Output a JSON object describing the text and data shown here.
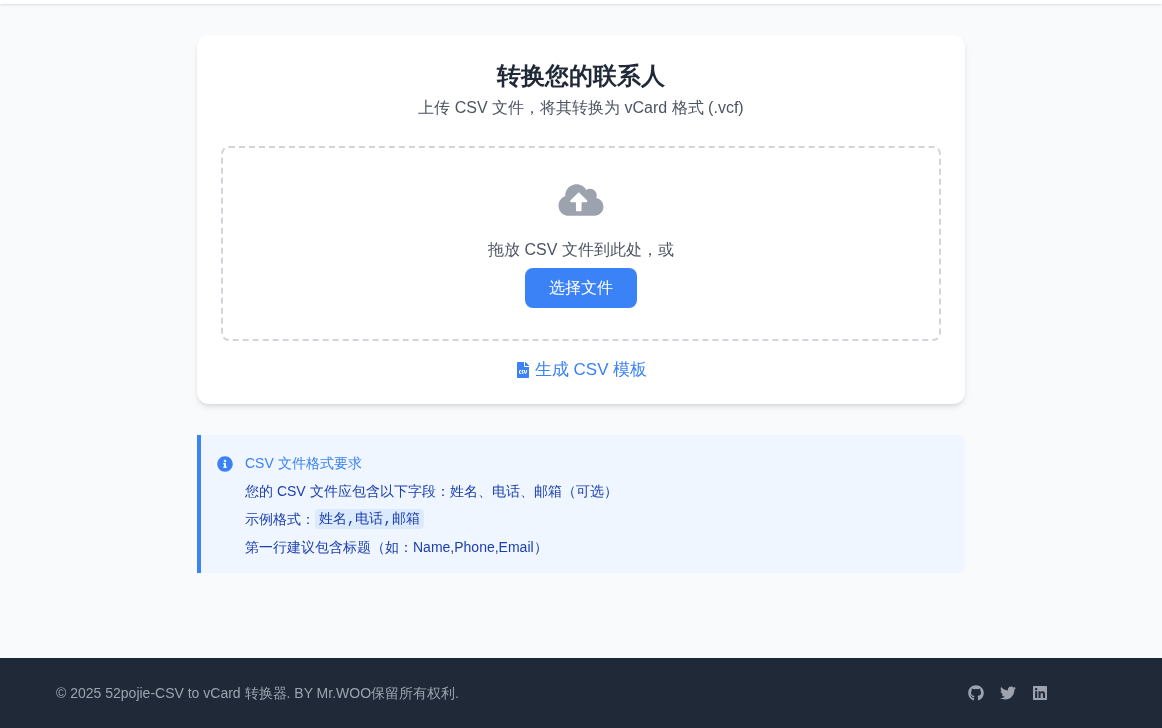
{
  "card": {
    "title": "转换您的联系人",
    "subtitle": "上传 CSV 文件，将其转换为 vCard 格式 (.vcf)"
  },
  "dropzone": {
    "prompt": "拖放 CSV 文件到此处，或",
    "button": "选择文件"
  },
  "template_link": "生成 CSV 模板",
  "info": {
    "title": "CSV 文件格式要求",
    "fields_line": "您的 CSV 文件应包含以下字段：姓名、电话、邮箱（可选）",
    "example_label": "示例格式：",
    "example_code": "姓名,电话,邮箱",
    "header_line": "第一行建议包含标题（如：Name,Phone,Email）"
  },
  "footer": {
    "copyright": "© 2025 52pojie-CSV to vCard 转换器. BY Mr.WOO保留所有权利."
  }
}
